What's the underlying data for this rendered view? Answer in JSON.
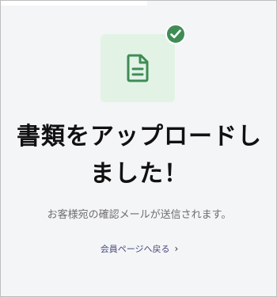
{
  "headline": {
    "line1": "書類をアップロードし",
    "line2": "ました！"
  },
  "subtext": "お客様宛の確認メールが送信されます。",
  "back_link": {
    "label": "会員ページへ戻る",
    "chevron": "›"
  },
  "icons": {
    "document": "document-icon",
    "check": "check-badge-icon",
    "chevron": "chevron-right-icon"
  },
  "colors": {
    "background": "#f4f5f7",
    "illustration_bg": "#e2f3e6",
    "accent_green": "#3f8c55",
    "headline_text": "#111111",
    "body_text": "#6e6e6e",
    "link_text": "#4a4f7c"
  }
}
